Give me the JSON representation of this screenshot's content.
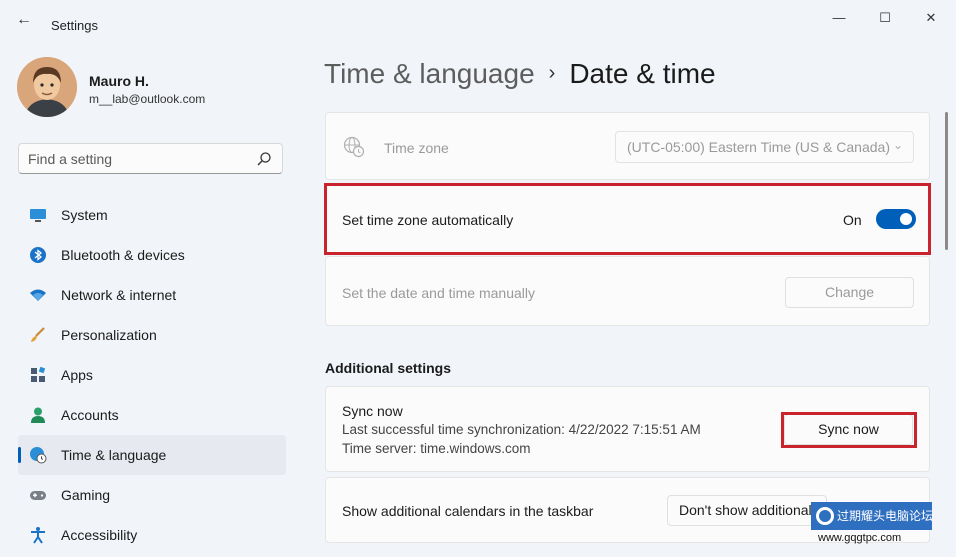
{
  "window": {
    "title": "Settings",
    "back_glyph": "←",
    "min_glyph": "—",
    "max_glyph": "☐",
    "close_glyph": "✕"
  },
  "profile": {
    "name": "Mauro H.",
    "email": "m__lab@outlook.com"
  },
  "search": {
    "placeholder": "Find a setting"
  },
  "sidebar": {
    "items": [
      {
        "label": "System",
        "icon": "monitor-icon"
      },
      {
        "label": "Bluetooth & devices",
        "icon": "bluetooth-icon"
      },
      {
        "label": "Network & internet",
        "icon": "wifi-icon"
      },
      {
        "label": "Personalization",
        "icon": "brush-icon"
      },
      {
        "label": "Apps",
        "icon": "apps-icon"
      },
      {
        "label": "Accounts",
        "icon": "person-icon"
      },
      {
        "label": "Time & language",
        "icon": "globe-clock-icon",
        "selected": true
      },
      {
        "label": "Gaming",
        "icon": "gamepad-icon"
      },
      {
        "label": "Accessibility",
        "icon": "accessibility-icon"
      }
    ]
  },
  "breadcrumb": {
    "parent": "Time & language",
    "separator": "›",
    "current": "Date & time"
  },
  "time_zone": {
    "label": "Time zone",
    "value": "(UTC-05:00) Eastern Time (US & Canada)",
    "chevron": "⌄"
  },
  "auto_time_zone": {
    "label": "Set time zone automatically",
    "state_label": "On",
    "enabled": true
  },
  "manual_time": {
    "label": "Set the date and time manually",
    "button_label": "Change"
  },
  "additional": {
    "title": "Additional settings"
  },
  "sync": {
    "title": "Sync now",
    "last_sync": "Last successful time synchronization: 4/22/2022 7:15:51 AM",
    "server": "Time server: time.windows.com",
    "button_label": "Sync now"
  },
  "calendars": {
    "label": "Show additional calendars in the taskbar",
    "value": "Don't show additional"
  },
  "watermark": {
    "badge_text": "过期耀头电脑论坛",
    "url": "www.gqgtpc.com"
  },
  "colors": {
    "accent": "#005fb8",
    "highlight": "#c9232d"
  }
}
